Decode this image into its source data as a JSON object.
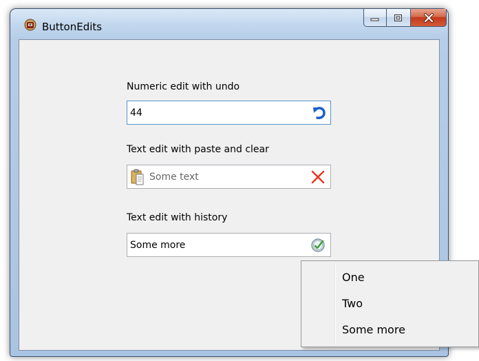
{
  "window": {
    "title": "ButtonEdits",
    "accent": "#a9c4e3",
    "close_color": "#c2391b"
  },
  "fields": {
    "numeric": {
      "label": "Numeric edit with undo",
      "value": "44",
      "button_icon": "undo-icon"
    },
    "paste_clear": {
      "label": "Text edit with paste and clear",
      "placeholder": "Some text",
      "left_icon": "clipboard-paste-icon",
      "button_icon": "clear-x-icon"
    },
    "history": {
      "label": "Text edit with history",
      "value": "Some more",
      "button_icon": "history-icon"
    }
  },
  "history_menu": {
    "items": [
      {
        "label": "One"
      },
      {
        "label": "Two"
      },
      {
        "label": "Some more"
      }
    ]
  }
}
